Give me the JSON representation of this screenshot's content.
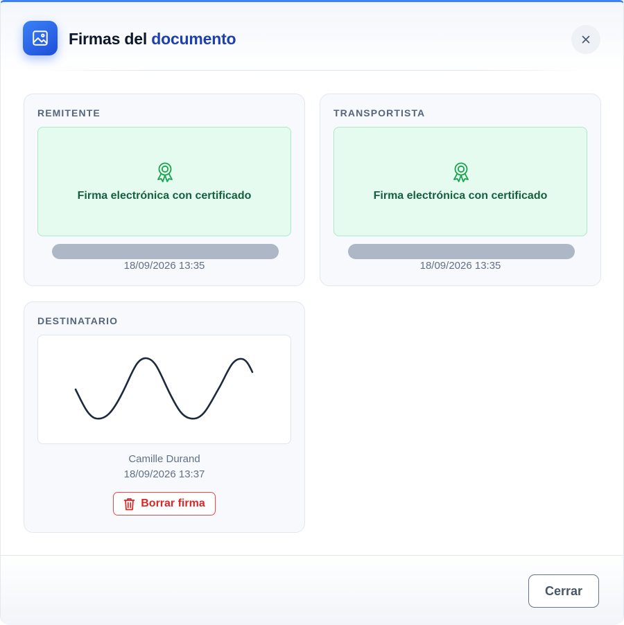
{
  "dialog": {
    "title_main": "Firmas del ",
    "title_accent": "documento",
    "close_icon": "close-icon",
    "header_icon": "image-icon"
  },
  "cards": {
    "remitente": {
      "label": "REMITENTE",
      "type": "certificate",
      "icon": "award-badge-icon",
      "certificate_text": "Firma electrónica con certificado",
      "date": "18/09/2026 13:35"
    },
    "transportista": {
      "label": "TRANSPORTISTA",
      "type": "certificate",
      "icon": "award-badge-icon",
      "certificate_text": "Firma electrónica con certificado",
      "date": "18/09/2026 13:35"
    },
    "destinatario": {
      "label": "DESTINATARIO",
      "type": "handwritten",
      "signer_name": "Camille Durand",
      "date": "18/09/2026 13:37",
      "delete_label": "Borrar firma",
      "delete_icon": "trash-icon"
    }
  },
  "footer": {
    "close_label": "Cerrar"
  },
  "colors": {
    "accent": "#2563eb",
    "certificate_bg": "#e6fbef",
    "certificate_text": "#15603f",
    "danger": "#dc2626"
  }
}
